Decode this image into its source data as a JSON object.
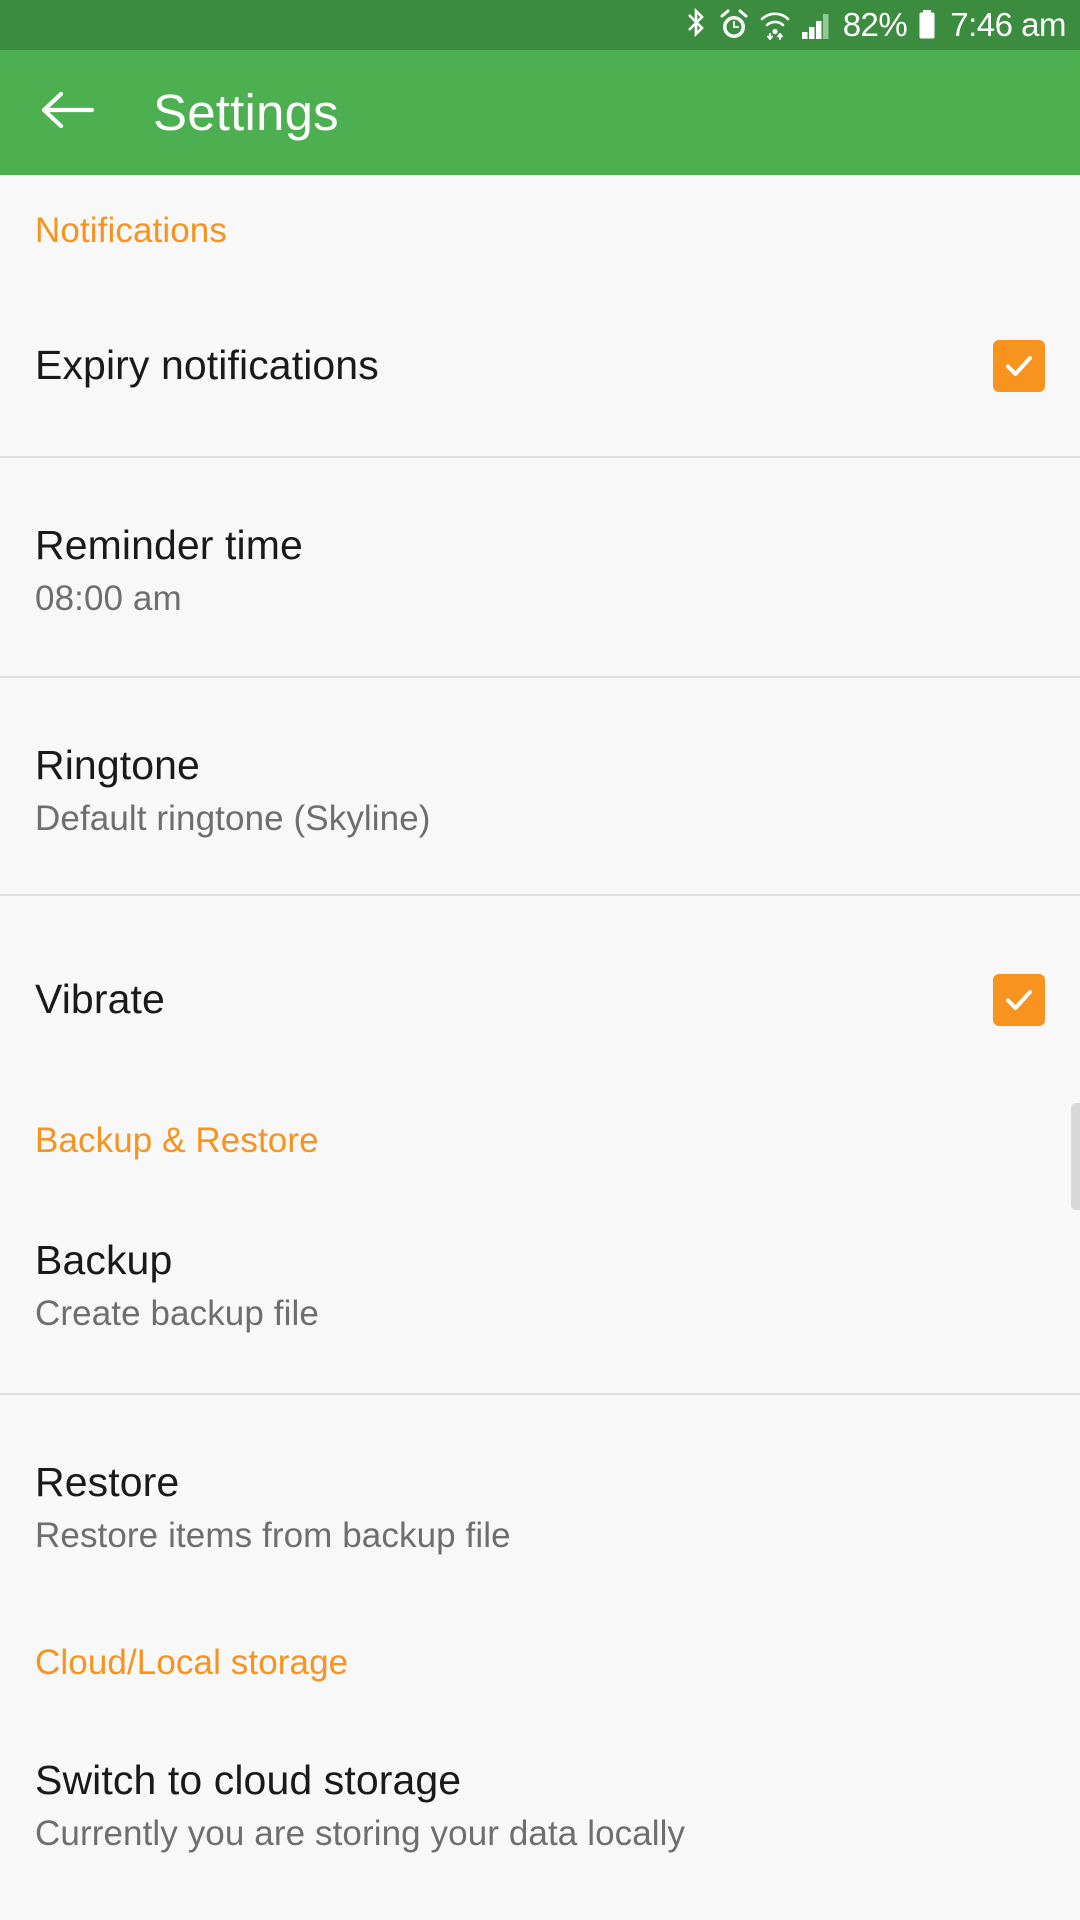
{
  "status_bar": {
    "icons": [
      "bluetooth-icon",
      "alarm-icon",
      "wifi-icon",
      "signal-icon",
      "battery-icon"
    ],
    "battery_percent": "82%",
    "time": "7:46 am",
    "background_color": "#3C8C40"
  },
  "app_bar": {
    "back_icon": "back-arrow-icon",
    "title": "Settings",
    "background_color": "#4CAF50"
  },
  "theme": {
    "accent_color": "#F7931E",
    "primary_color": "#4CAF50",
    "background_color": "#F8F8F8",
    "title_color": "#1A1A1A",
    "summary_color": "#6E6E6E",
    "divider_color": "#E0E0E0"
  },
  "sections": [
    {
      "header": "Notifications",
      "rows": [
        {
          "title": "Expiry notifications",
          "summary": "",
          "control": "checkbox",
          "checked": true
        },
        {
          "title": "Reminder time",
          "summary": "08:00 am",
          "control": "none",
          "checked": false
        },
        {
          "title": "Ringtone",
          "summary": "Default ringtone (Skyline)",
          "control": "none",
          "checked": false
        },
        {
          "title": "Vibrate",
          "summary": "",
          "control": "checkbox",
          "checked": true
        }
      ]
    },
    {
      "header": "Backup & Restore",
      "rows": [
        {
          "title": "Backup",
          "summary": "Create backup file",
          "control": "none",
          "checked": false
        },
        {
          "title": "Restore",
          "summary": "Restore items from backup file",
          "control": "none",
          "checked": false
        }
      ]
    },
    {
      "header": "Cloud/Local storage",
      "rows": [
        {
          "title": "Switch to cloud storage",
          "summary": "Currently you are storing your data locally",
          "control": "none",
          "checked": false
        }
      ]
    }
  ]
}
